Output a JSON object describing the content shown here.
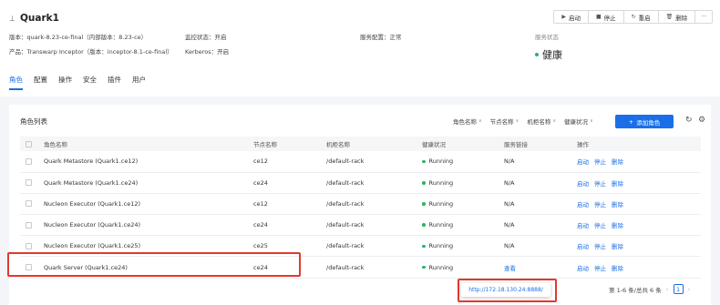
{
  "service": {
    "pin_icon": "pin-icon",
    "name": "Quark1",
    "version": "版本：quark-8.23-ce-final（内部版本：8.23-ce）",
    "product": "产品：Transwarp Inceptor（版本：inceptor-8.1-ce-final）",
    "monitor": "监控状态：开启",
    "kerberos": "Kerberos：开启",
    "config": "服务配置：正常",
    "health_label": "服务状态",
    "health_value": "健康"
  },
  "actions": [
    {
      "icon": "play-icon",
      "glyph": "▶",
      "label": "启动"
    },
    {
      "icon": "stop-icon",
      "glyph": "■",
      "label": "停止"
    },
    {
      "icon": "restart-icon",
      "glyph": "↻",
      "label": "重启"
    },
    {
      "icon": "delete-icon",
      "glyph": "🗑",
      "label": "删除"
    },
    {
      "icon": "more-icon",
      "glyph": "···",
      "label": ""
    }
  ],
  "tabs": [
    "角色",
    "配置",
    "操作",
    "安全",
    "插件",
    "用户"
  ],
  "panel": {
    "title": "角色列表",
    "filters": [
      "角色名称",
      "节点名称",
      "机柜名称",
      "健康状况"
    ],
    "add_button": "添加角色"
  },
  "table": {
    "headers": [
      "角色名称",
      "节点名称",
      "机柜名称",
      "健康状况",
      "服务链接",
      "操作"
    ],
    "rows": [
      {
        "role": "Quark Metastore (Quark1.ce12)",
        "node": "ce12",
        "rack": "/default-rack",
        "health": "Running",
        "link": "N/A"
      },
      {
        "role": "Quark Metastore (Quark1.ce24)",
        "node": "ce24",
        "rack": "/default-rack",
        "health": "Running",
        "link": "N/A"
      },
      {
        "role": "Nucleon Executor (Quark1.ce12)",
        "node": "ce12",
        "rack": "/default-rack",
        "health": "Running",
        "link": "N/A"
      },
      {
        "role": "Nucleon Executor (Quark1.ce24)",
        "node": "ce24",
        "rack": "/default-rack",
        "health": "Running",
        "link": "N/A"
      },
      {
        "role": "Nucleon Executor (Quark1.ce25)",
        "node": "ce25",
        "rack": "/default-rack",
        "health": "Running",
        "link": "N/A"
      },
      {
        "role": "Quark Server (Quark1.ce24)",
        "node": "ce24",
        "rack": "/default-rack",
        "health": "Running",
        "link": "查看"
      }
    ],
    "row_actions": [
      "启动",
      "停止",
      "删除"
    ]
  },
  "tooltip": "http://172.18.130.24:8888/",
  "pagination": {
    "summary": "第 1-6 条/总共 6 条",
    "page": "1"
  },
  "colors": {
    "accent": "#1a6fe8",
    "running": "#2db36a",
    "highlight": "#e3382e"
  }
}
